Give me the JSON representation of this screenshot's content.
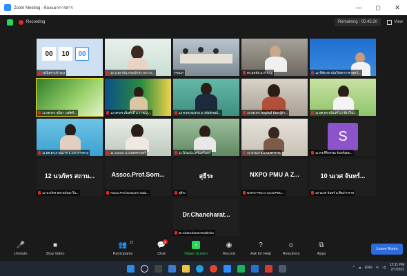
{
  "window": {
    "title": "Zoom Meeting - ห้องแยกการสาร",
    "minimize": "—",
    "maximize": "◻",
    "close": "✕"
  },
  "status": {
    "recording": "Recording",
    "remaining": "Remaining : 05:45:20",
    "view": "View"
  },
  "countdown": [
    "00",
    "10",
    "00"
  ],
  "tiles": [
    {
      "label": "วนวิเคราะห์ กผ.2"
    },
    {
      "label": "12 ม.สถาบัน กรมเจ้าท่า ยกวาง..."
    },
    {
      "label": "PMUA"
    },
    {
      "label": "ดร.สมชัย ม.ราชภัฏ"
    },
    {
      "label": "12 พิชัย สถาบันวิจัยดาราศาสตร์..."
    },
    {
      "label": "12 ผศ.ดร. สุนิสา วงศ์ศรี..."
    },
    {
      "label": "12 ผศ.ดร.เพิ่มศักดิ์ ม.ราชภัฏ..."
    },
    {
      "label": "12 ศ.ดร.สมชาย ม.วลัยลักษณ์..."
    },
    {
      "label": "10 ผศ.ดร.เรณูพันธ์ มีผล ผู้อำ..."
    },
    {
      "label": "11 ผศ.ดร.ชนินทร์ ม.เชียงใหม่..."
    },
    {
      "label": "11 ผศ.ดร.ภาณุมาศ ม.มหาสารคาม"
    },
    {
      "label": "11 Somsri ม.เกษตรศาสตร์"
    },
    {
      "label": "11 นิวัฒน์ ม.ศรีนครินทร์"
    },
    {
      "label": "10 ส่วนงาน ม.นเรศวร #1"
    },
    {
      "label": "11 ดร.ศิริพรรณ จันทร์อุดม..."
    },
    {
      "label": "12 นวภัทร สถานบันนาโน...",
      "big": "12 นวภัทร สถาน..."
    },
    {
      "label": "Assoc.Prof.Somporn Isala...",
      "big": "Assoc.Prof.Som..."
    },
    {
      "label": "สุธีระ",
      "big": "สุธีระ"
    },
    {
      "label": "NXPO PMU A ZoomPMU...",
      "big": "NXPO PMU A Z..."
    },
    {
      "label": "10 นเวศ จันทร์ ม.ศิลปากร #2",
      "big": "10 นเวศ จันทร์..."
    },
    {
      "label": "Dr.Chancharat Neodecha",
      "big": "Dr.Chancharat..."
    }
  ],
  "avatar_letter": "S",
  "toolbar": {
    "unmute": "Unmute",
    "stop_video": "Stop Video",
    "participants": "Participants",
    "participants_count": "21",
    "chat": "Chat",
    "chat_badge": "2",
    "share_screen": "Share Screen",
    "record": "Record",
    "ask_help": "Ask for Help",
    "reactions": "Reactions",
    "apps": "Apps",
    "leave": "Leave Room"
  },
  "taskbar": {
    "lang": "ENG",
    "time": "12:31 PM",
    "date": "2/7/2022"
  }
}
